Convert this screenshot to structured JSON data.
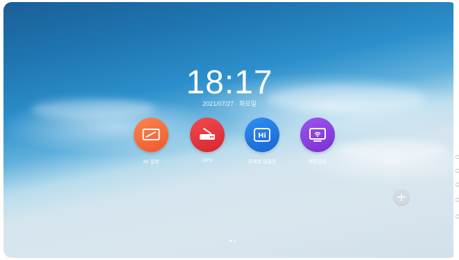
{
  "time": "18:17",
  "date": "2021/07/27 · 화요일",
  "apps": [
    {
      "label": "4K 칠판",
      "icon": "whiteboard-icon",
      "color": "#f36b3a"
    },
    {
      "label": "OPS",
      "icon": "router-icon",
      "color": "#e5333c"
    },
    {
      "label": "주제별 템플릿",
      "icon": "hi-template-icon",
      "color": "#1f7be3"
    },
    {
      "label": "화면공유",
      "icon": "screen-share-icon",
      "color": "#8a3fe0"
    }
  ],
  "colors": {
    "sea_top": "#1a5f97",
    "sand": "#d9e6ee"
  }
}
